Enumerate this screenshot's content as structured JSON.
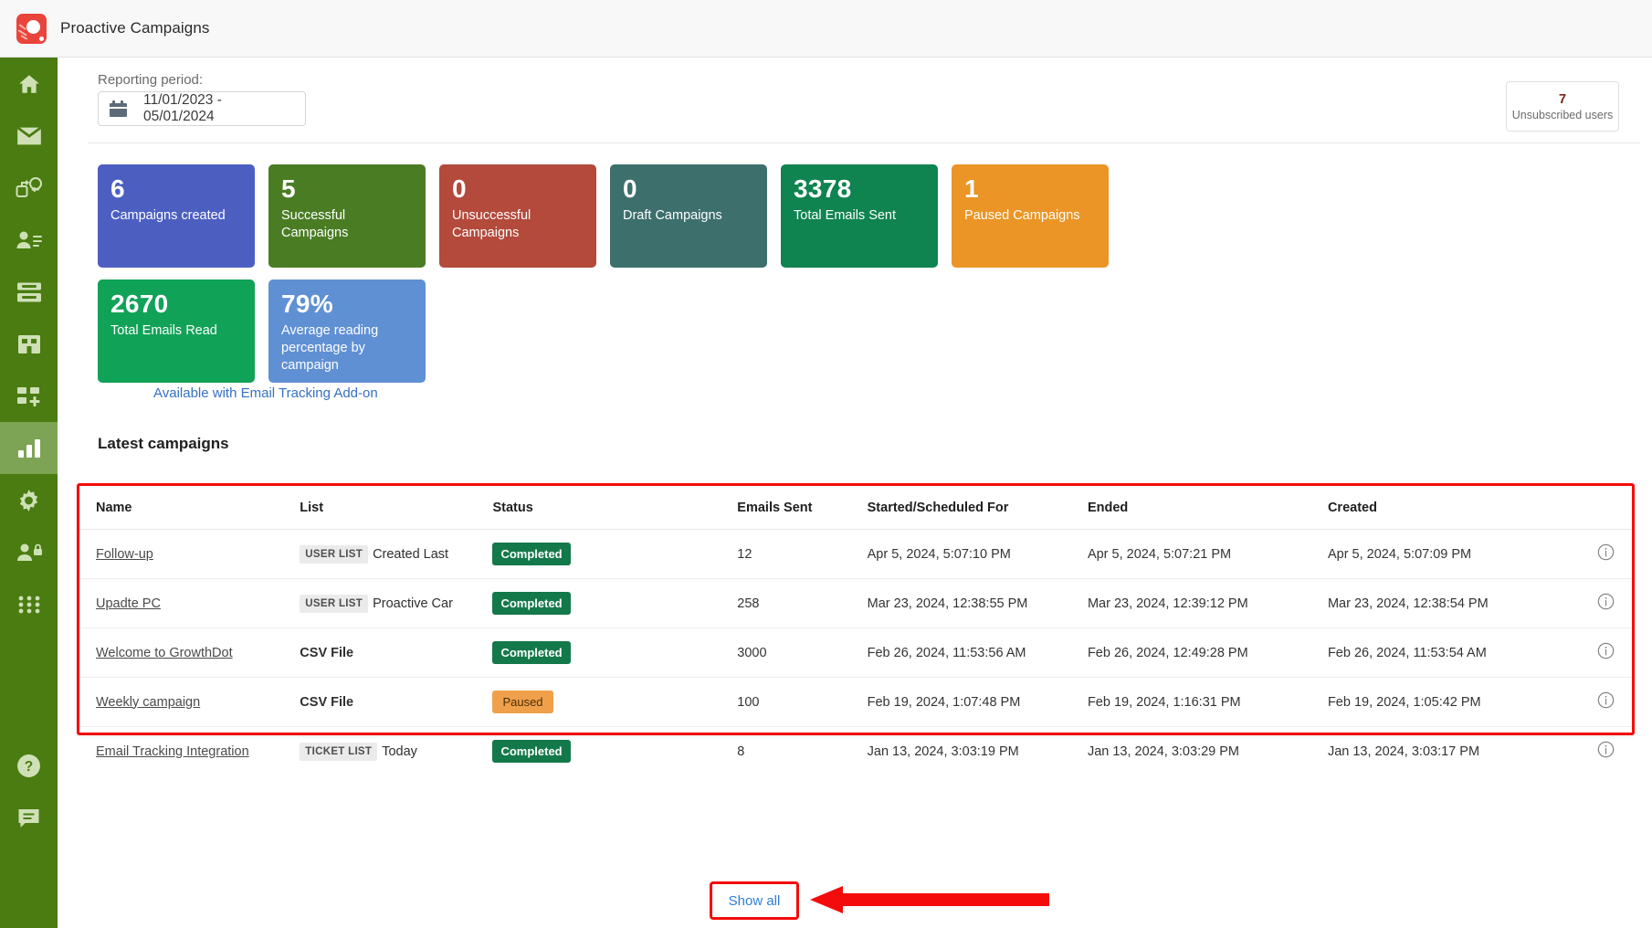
{
  "app": {
    "title": "Proactive Campaigns",
    "logo_icon": "proactive-campaigns-logo"
  },
  "sidebar": {
    "items": [
      {
        "icon": "home-icon",
        "name": "home",
        "active": false
      },
      {
        "icon": "envelope-icon",
        "name": "mail",
        "active": false
      },
      {
        "icon": "refresh-cycle-icon",
        "name": "automation",
        "active": false
      },
      {
        "icon": "contact-list-icon",
        "name": "contacts",
        "active": false
      },
      {
        "icon": "knowledge-base-icon",
        "name": "knowledge-base",
        "active": false
      },
      {
        "icon": "company-icon",
        "name": "companies",
        "active": false
      },
      {
        "icon": "add-widget-icon",
        "name": "add-app",
        "active": false
      },
      {
        "icon": "bar-chart-icon",
        "name": "reports",
        "active": true
      },
      {
        "icon": "gear-icon",
        "name": "settings",
        "active": false
      },
      {
        "icon": "user-lock-icon",
        "name": "permissions",
        "active": false
      },
      {
        "icon": "grid-dots-icon",
        "name": "apps",
        "active": false
      }
    ],
    "bottom_items": [
      {
        "icon": "help-circle-icon",
        "name": "help"
      },
      {
        "icon": "chat-bubble-icon",
        "name": "feedback"
      }
    ]
  },
  "filters": {
    "reporting_period_label": "Reporting period:",
    "date_range_value": "11/01/2023 - 05/01/2024",
    "calendar_icon": "calendar-icon"
  },
  "unsubscribed": {
    "count": "7",
    "label": "Unsubscribed users"
  },
  "stat_cards": [
    {
      "value": "6",
      "label": "Campaigns created",
      "color": "#4c5fc1"
    },
    {
      "value": "5",
      "label": "Successful Campaigns",
      "color": "#4a7c24"
    },
    {
      "value": "0",
      "label": "Unsuccessful Campaigns",
      "color": "#b34a3c"
    },
    {
      "value": "0",
      "label": "Draft Campaigns",
      "color": "#3d6f6d"
    },
    {
      "value": "3378",
      "label": "Total Emails Sent",
      "color": "#0f8350"
    },
    {
      "value": "1",
      "label": "Paused Campaigns",
      "color": "#ea9526"
    },
    {
      "value": "2670",
      "label": "Total Emails Read",
      "color": "#10a257"
    },
    {
      "value": "79%",
      "label": "Average reading percentage by campaign",
      "color": "#6090d4"
    }
  ],
  "addon_note": "Available with Email Tracking Add-on",
  "latest_campaigns": {
    "title": "Latest campaigns",
    "columns": [
      "Name",
      "List",
      "Status",
      "Emails Sent",
      "Started/Scheduled For",
      "Ended",
      "Created"
    ],
    "rows": [
      {
        "name": "Follow-up",
        "list_tag": "USER LIST",
        "list_name": "Created Last",
        "list_bold": false,
        "status": "Completed",
        "status_kind": "completed",
        "emails_sent": "12",
        "started": "Apr 5, 2024, 5:07:10 PM",
        "ended": "Apr 5, 2024, 5:07:21 PM",
        "created": "Apr 5, 2024, 5:07:09 PM",
        "info_icon": "info-circle-icon"
      },
      {
        "name": "Upadte PC",
        "list_tag": "USER LIST",
        "list_name": "Proactive Car",
        "list_bold": false,
        "status": "Completed",
        "status_kind": "completed",
        "emails_sent": "258",
        "started": "Mar 23, 2024, 12:38:55 PM",
        "ended": "Mar 23, 2024, 12:39:12 PM",
        "created": "Mar 23, 2024, 12:38:54 PM",
        "info_icon": "info-circle-icon"
      },
      {
        "name": "Welcome to GrowthDot",
        "list_tag": "",
        "list_name": "CSV File",
        "list_bold": true,
        "status": "Completed",
        "status_kind": "completed",
        "emails_sent": "3000",
        "started": "Feb 26, 2024, 11:53:56 AM",
        "ended": "Feb 26, 2024, 12:49:28 PM",
        "created": "Feb 26, 2024, 11:53:54 AM",
        "info_icon": "info-circle-icon"
      },
      {
        "name": "Weekly campaign",
        "list_tag": "",
        "list_name": "CSV File",
        "list_bold": true,
        "status": "Paused",
        "status_kind": "paused",
        "emails_sent": "100",
        "started": "Feb 19, 2024, 1:07:48 PM",
        "ended": "Feb 19, 2024, 1:16:31 PM",
        "created": "Feb 19, 2024, 1:05:42 PM",
        "info_icon": "info-circle-icon"
      },
      {
        "name": "Email Tracking Integration",
        "list_tag": "TICKET LIST",
        "list_name": "Today",
        "list_bold": false,
        "status": "Completed",
        "status_kind": "completed",
        "emails_sent": "8",
        "started": "Jan 13, 2024, 3:03:19 PM",
        "ended": "Jan 13, 2024, 3:03:29 PM",
        "created": "Jan 13, 2024, 3:03:17 PM",
        "info_icon": "info-circle-icon"
      }
    ]
  },
  "footer": {
    "show_all_label": "Show all"
  },
  "annotations": {
    "highlight_color": "#f40b0b",
    "arrow_color": "#f40b0b"
  }
}
